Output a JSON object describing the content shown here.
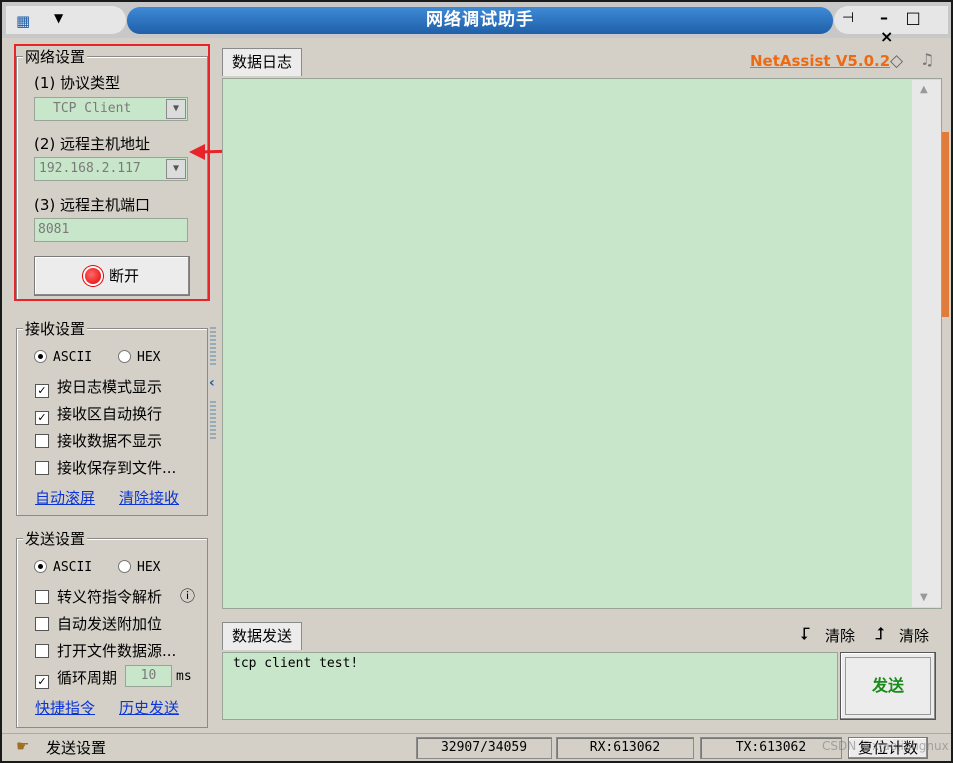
{
  "window": {
    "title": "网络调试助手",
    "menu_arrow": "▼",
    "pin": "⊣",
    "controls": "– □ ×"
  },
  "brand": {
    "name": "NetAssist V5.0.2"
  },
  "network": {
    "group_title": "网络设置",
    "protocol_label": "(1) 协议类型",
    "protocol_value": "TCP Client",
    "host_label": "(2) 远程主机地址",
    "host_value": "192.168.2.117",
    "port_label": "(3) 远程主机端口",
    "port_value": "8081",
    "disconnect_label": "断开"
  },
  "receive": {
    "group_title": "接收设置",
    "ascii_label": "ASCII",
    "hex_label": "HEX",
    "options": [
      {
        "label": "按日志模式显示",
        "checked": true
      },
      {
        "label": "接收区自动换行",
        "checked": true
      },
      {
        "label": "接收数据不显示",
        "checked": false
      },
      {
        "label": "接收保存到文件...",
        "checked": false
      }
    ],
    "link_autoscroll": "自动滚屏",
    "link_clear": "清除接收"
  },
  "send": {
    "group_title": "发送设置",
    "ascii_label": "ASCII",
    "hex_label": "HEX",
    "options": [
      {
        "label": "转义符指令解析",
        "checked": false
      },
      {
        "label": "自动发送附加位",
        "checked": false
      },
      {
        "label": "打开文件数据源...",
        "checked": false
      },
      {
        "label": "循环周期",
        "checked": true
      }
    ],
    "period_value": "10",
    "period_unit": "ms",
    "link_shortcut": "快捷指令",
    "link_history": "历史发送",
    "info_icon": "ⓘ"
  },
  "log_tab": {
    "label": "数据日志"
  },
  "send_tab": {
    "label": "数据发送",
    "clear1": "清除",
    "clear2": "清除",
    "text": "tcp client test!",
    "send_button": "发送"
  },
  "statusbar": {
    "left_label": "发送设置",
    "counter": "32907/34059",
    "rx": "RX:613062",
    "tx": "TX:613062",
    "reset": "复位计数"
  },
  "watermark": "CSDN @xiaojiangnux",
  "colors": {
    "accent_red": "#e8232a",
    "brand_orange": "#ee6a12",
    "link_blue": "#0a34d6",
    "field_green": "#c8e6c9",
    "send_green": "#1a8a1a"
  }
}
